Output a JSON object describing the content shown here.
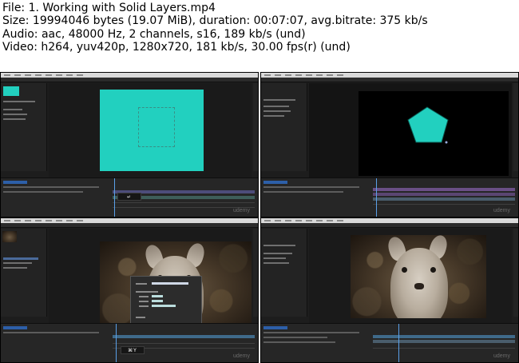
{
  "header": {
    "file": "File: 1. Working with Solid Layers.mp4",
    "size": "Size: 19994046 bytes (19.07 MiB), duration: 00:07:07, avg.bitrate: 375 kb/s",
    "audio": "Audio: aac, 48000 Hz, 2 channels, s16, 189 kb/s (und)",
    "video": "Video: h264, yuv420p, 1280x720, 181 kb/s, 30.00 fps(r) (und)"
  },
  "thumbnails": [
    {
      "caption": "↵",
      "watermark": "udemy"
    },
    {
      "watermark": "udemy"
    },
    {
      "caption": "⌘Y",
      "watermark": "udemy"
    },
    {
      "watermark": "udemy"
    }
  ],
  "colors": {
    "solid_teal": "#22d0bf",
    "ui_dark": "#1d1d1d",
    "playhead": "#5aa0e8"
  }
}
